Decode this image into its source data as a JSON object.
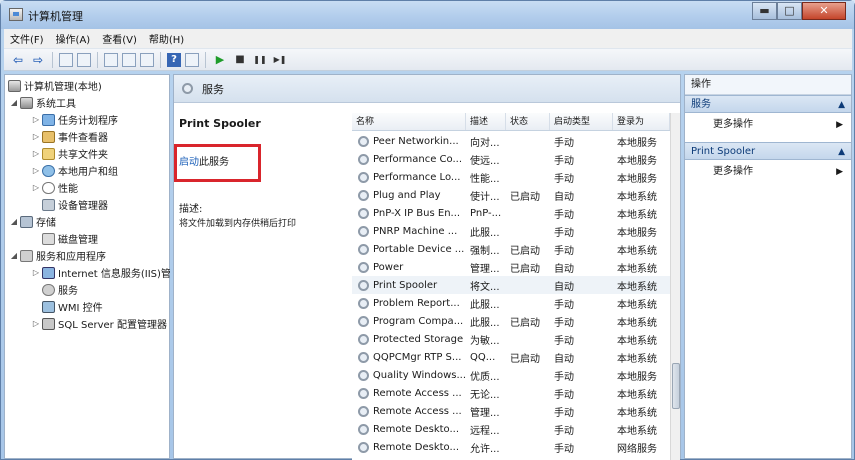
{
  "window": {
    "title": "计算机管理",
    "min_glyph": "▬",
    "max_glyph": "□",
    "close_glyph": "✕"
  },
  "menu": [
    "文件(F)",
    "操作(A)",
    "查看(V)",
    "帮助(H)"
  ],
  "toolbar": {
    "back_glyph": "⇦",
    "forward_glyph": "⇨",
    "play_glyph": "▶",
    "stop_glyph": "■",
    "pause_glyph": "❚❚",
    "restart_glyph": "▶❚",
    "help_glyph": "?"
  },
  "tree": {
    "root": "计算机管理(本地)",
    "system_tools": "系统工具",
    "task_scheduler": "任务计划程序",
    "event_viewer": "事件查看器",
    "shared_folders": "共享文件夹",
    "local_users": "本地用户和组",
    "performance": "性能",
    "device_manager": "设备管理器",
    "storage": "存储",
    "disk_management": "磁盘管理",
    "services_apps": "服务和应用程序",
    "iis": "Internet 信息服务(IIS)管",
    "services": "服务",
    "wmi": "WMI 控件",
    "sql": "SQL Server 配置管理器"
  },
  "middle": {
    "header_title": "服务",
    "service_name": "Print Spooler",
    "start_link": "启动",
    "start_suffix": "此服务",
    "description_label": "描述:",
    "description_text": "将文件加载到内存供稍后打印"
  },
  "list": {
    "columns": [
      "名称",
      "描述",
      "状态",
      "启动类型",
      "登录为"
    ],
    "rows": [
      {
        "name": "Peer Networkin...",
        "desc": "向对...",
        "status": "",
        "startup": "手动",
        "logon": "本地服务"
      },
      {
        "name": "Performance Co...",
        "desc": "使远...",
        "status": "",
        "startup": "手动",
        "logon": "本地服务"
      },
      {
        "name": "Performance Lo...",
        "desc": "性能...",
        "status": "",
        "startup": "手动",
        "logon": "本地服务"
      },
      {
        "name": "Plug and Play",
        "desc": "使计...",
        "status": "已启动",
        "startup": "自动",
        "logon": "本地系统"
      },
      {
        "name": "PnP-X IP Bus En...",
        "desc": "PnP-...",
        "status": "",
        "startup": "手动",
        "logon": "本地系统"
      },
      {
        "name": "PNRP Machine ...",
        "desc": "此服...",
        "status": "",
        "startup": "手动",
        "logon": "本地服务"
      },
      {
        "name": "Portable Device ...",
        "desc": "强制...",
        "status": "已启动",
        "startup": "手动",
        "logon": "本地系统"
      },
      {
        "name": "Power",
        "desc": "管理...",
        "status": "已启动",
        "startup": "自动",
        "logon": "本地系统"
      },
      {
        "name": "Print Spooler",
        "desc": "将文...",
        "status": "",
        "startup": "自动",
        "logon": "本地系统"
      },
      {
        "name": "Problem Report...",
        "desc": "此服...",
        "status": "",
        "startup": "手动",
        "logon": "本地系统"
      },
      {
        "name": "Program Compa...",
        "desc": "此服...",
        "status": "已启动",
        "startup": "手动",
        "logon": "本地系统"
      },
      {
        "name": "Protected Storage",
        "desc": "为敏...",
        "status": "",
        "startup": "手动",
        "logon": "本地系统"
      },
      {
        "name": "QQPCMgr RTP S...",
        "desc": "QQ...",
        "status": "已启动",
        "startup": "自动",
        "logon": "本地系统"
      },
      {
        "name": "Quality Windows...",
        "desc": "优质...",
        "status": "",
        "startup": "手动",
        "logon": "本地服务"
      },
      {
        "name": "Remote Access ...",
        "desc": "无论...",
        "status": "",
        "startup": "手动",
        "logon": "本地系统"
      },
      {
        "name": "Remote Access ...",
        "desc": "管理...",
        "status": "",
        "startup": "手动",
        "logon": "本地系统"
      },
      {
        "name": "Remote Deskto...",
        "desc": "远程...",
        "status": "",
        "startup": "手动",
        "logon": "本地系统"
      },
      {
        "name": "Remote Deskto...",
        "desc": "允许...",
        "status": "",
        "startup": "手动",
        "logon": "网络服务"
      },
      {
        "name": "Remote Deskto...",
        "desc": "允许...",
        "status": "",
        "startup": "手动",
        "logon": "本地系统"
      }
    ]
  },
  "actions": {
    "title": "操作",
    "section1": "服务",
    "more1": "更多操作",
    "section2": "Print Spooler",
    "more2": "更多操作",
    "collapse_glyph": "▲",
    "arrow_glyph": "▶"
  }
}
